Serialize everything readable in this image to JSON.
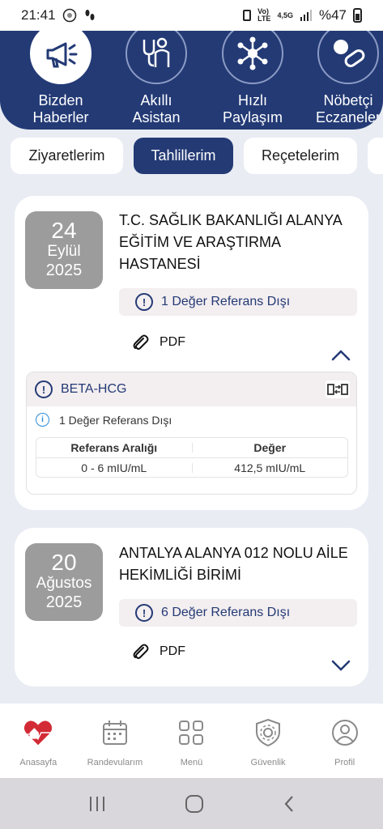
{
  "status_bar": {
    "time": "21:41",
    "network_volte": "Vo)",
    "network_lte": "LTE",
    "network_type": "4,5G",
    "battery": "%47"
  },
  "quick_links": [
    {
      "label_line1": "Bizden",
      "label_line2": "Haberler",
      "icon": "megaphone-icon",
      "active": true
    },
    {
      "label_line1": "Akıllı",
      "label_line2": "Asistan",
      "icon": "doctor-icon",
      "active": false
    },
    {
      "label_line1": "Hızlı",
      "label_line2": "Paylaşım",
      "icon": "network-share-icon",
      "active": false
    },
    {
      "label_line1": "Nöbetçi",
      "label_line2": "Eczaneler",
      "icon": "pill-icon",
      "active": false
    }
  ],
  "tabs": [
    {
      "label": "Ziyaretlerim",
      "active": false
    },
    {
      "label": "Tahlillerim",
      "active": true
    },
    {
      "label": "Reçetelerim",
      "active": false
    }
  ],
  "results": [
    {
      "day": "24",
      "month": "Eylül",
      "year": "2025",
      "hospital": "T.C. SAĞLIK BAKANLIĞI ALANYA EĞİTİM VE ARAŞTIRMA HASTANESİ",
      "reference_summary": "1 Değer Referans Dışı",
      "pdf_label": "PDF",
      "expanded": true,
      "tests": [
        {
          "name": "BETA-HCG",
          "out_of_range_note": "1 Değer Referans Dışı",
          "col_reference": "Referans Aralığı",
          "col_value": "Değer",
          "reference_range": "0 - 6 mIU/mL",
          "value": "412,5 mIU/mL"
        }
      ]
    },
    {
      "day": "20",
      "month": "Ağustos",
      "year": "2025",
      "hospital": "ANTALYA ALANYA 012 NOLU AİLE HEKİMLİĞİ BİRİMİ",
      "reference_summary": "6 Değer Referans Dışı",
      "pdf_label": "PDF",
      "expanded": false
    }
  ],
  "bottom_nav": [
    {
      "label": "Anasayfa",
      "icon": "heart-home-icon"
    },
    {
      "label": "Randevularım",
      "icon": "calendar-icon"
    },
    {
      "label": "Menü",
      "icon": "grid-menu-icon"
    },
    {
      "label": "Güvenlik",
      "icon": "shield-gear-icon"
    },
    {
      "label": "Profil",
      "icon": "profile-icon"
    }
  ],
  "colors": {
    "primary_navy": "#233a75",
    "background": "#e9ecf3",
    "date_box_gray": "#9c9c9c",
    "warning_pill": "#f3eef0",
    "home_red": "#d32b36"
  }
}
